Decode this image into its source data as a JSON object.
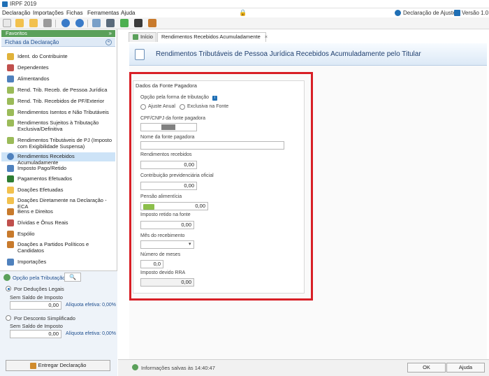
{
  "window": {
    "title": "IRPF 2019"
  },
  "menu": {
    "items": [
      "Declaração",
      "Importações",
      "Fichas",
      "Ferramentas",
      "Ajuda"
    ],
    "right": {
      "declaration_type": "Declaração de Ajuste",
      "version": "Versão 1.0"
    }
  },
  "sidebar": {
    "favorites": "Favoritos",
    "fichas": "Fichas da Declaração",
    "items": [
      "Ident. do Contribuinte",
      "Dependentes",
      "Alimentandos",
      "Rend. Trib. Receb. de Pessoa Jurídica",
      "Rend. Trib. Recebidos de PF/Exterior",
      "Rendimentos Isentos e Não Tributáveis",
      "Rendimentos Sujeitos à Tributação Exclusiva/Definitiva",
      "Rendimentos Tributáveis de PJ (Imposto com Exigibilidade Suspensa)",
      "Rendimentos Recebidos Acumuladamente",
      "Imposto Pago/Retido",
      "Pagamentos Efetuados",
      "Doações Efetuadas",
      "Doações Diretamente na Declaração - ECA",
      "Bens e Direitos",
      "Dívidas e Ônus Reais",
      "Espólio",
      "Doações a Partidos Políticos e Candidatos",
      "Importações"
    ]
  },
  "tax_option": {
    "title": "Opção pela Tributação:",
    "search_icon": "🔍",
    "legal": {
      "label": "Por Deduções Legais",
      "sub": "Sem Saldo de Imposto",
      "value": "0,00",
      "rate": "Alíquota efetiva: 0,00%"
    },
    "simplified": {
      "label": "Por Desconto Simplificado",
      "sub": "Sem Saldo de Imposto",
      "value": "0,00",
      "rate": "Alíquota efetiva: 0,00%"
    },
    "send_button": "Entregar Declaração"
  },
  "tabs": [
    {
      "label": "Início"
    },
    {
      "label": "Rendimentos Recebidos Acumuladamente",
      "close": "×"
    }
  ],
  "page": {
    "title": "Rendimentos Tributáveis de Pessoa Jurídica Recebidos Acumuladamente pelo Titular"
  },
  "form": {
    "section": "Dados da Fonte Pagadora",
    "tax_option_label": "Opção pela forma de tributação",
    "info": "i",
    "options": [
      "Ajuste Anual",
      "Exclusiva na Fonte"
    ],
    "cpf_cnpj_label": "CPF/CNPJ da fonte pagadora",
    "name_label": "Nome da fonte pagadora",
    "income_label": "Rendimentos recebidos",
    "income_value": "0,00",
    "social_security_label": "Contribuição previdenciária oficial",
    "social_security_value": "0,00",
    "alimony_label": "Pensão alimentícia",
    "alimony_value": "0,00",
    "withheld_label": "Imposto retido na fonte",
    "withheld_value": "0,00",
    "month_label": "Mês do recebimento",
    "month_chevron": "▾",
    "months_count_label": "Número de meses",
    "months_count_value": "0,0",
    "rra_tax_label": "Imposto devido RRA",
    "rra_tax_value": "0,00"
  },
  "status": {
    "saved_text": "Informações salvas às 14:40:47",
    "ok_button": "OK",
    "help_button": "Ajuda"
  },
  "colors": {
    "highlight": "#d81f26",
    "accent": "#1f6fb5",
    "green": "#5aa05a"
  }
}
